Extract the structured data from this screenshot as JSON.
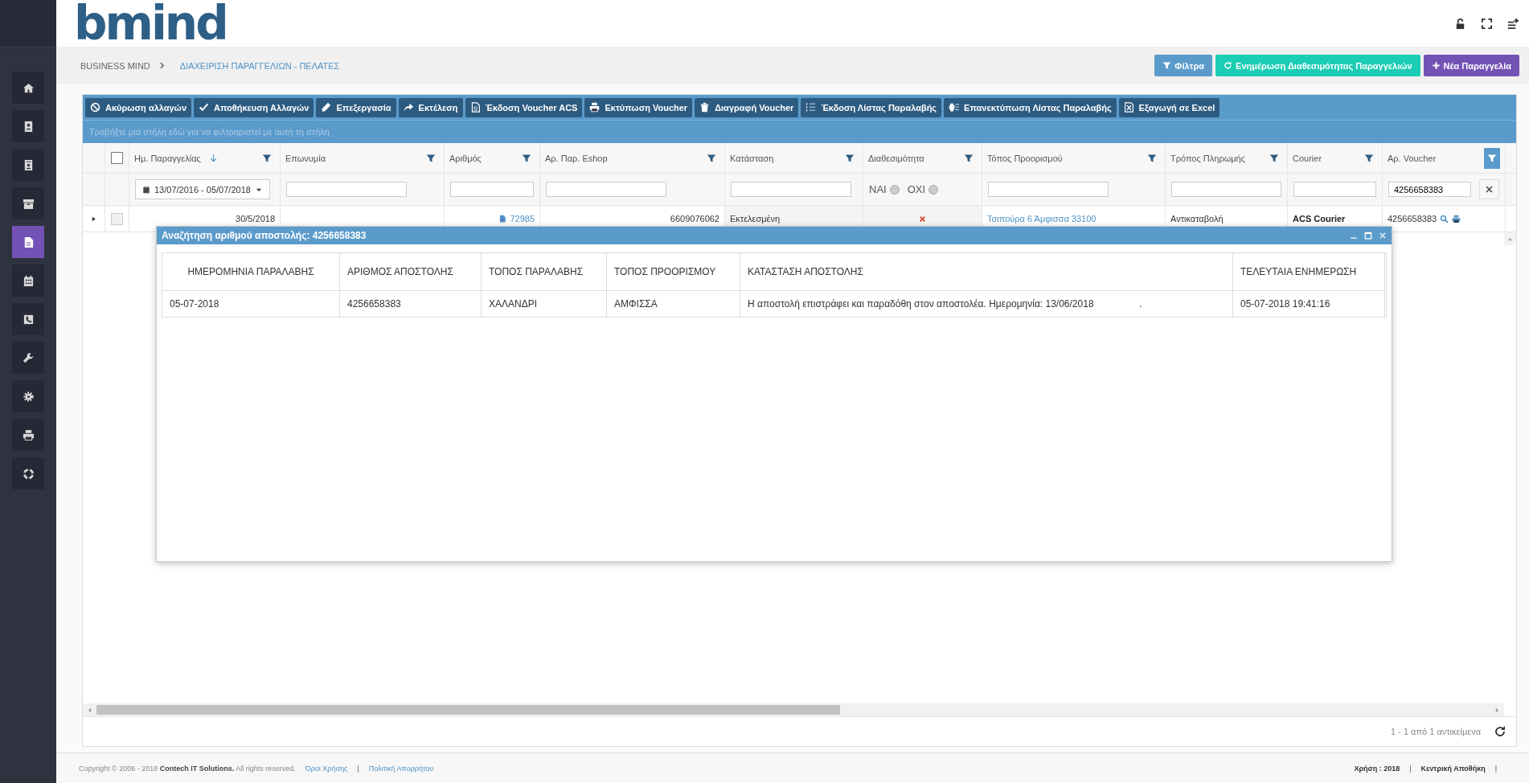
{
  "logo": {
    "text": "bmind"
  },
  "sidebar": {
    "items": [
      {
        "selected": false
      },
      {
        "selected": false
      },
      {
        "selected": false
      },
      {
        "selected": false
      },
      {
        "selected": true
      },
      {
        "selected": false
      },
      {
        "selected": false
      },
      {
        "selected": false
      },
      {
        "selected": false
      },
      {
        "selected": false
      },
      {
        "selected": false
      }
    ]
  },
  "breadcrumb": {
    "root": "BUSINESS MIND",
    "current": "ΔΙΑΧΕΙΡΙΣΗ ΠΑΡΑΓΓΕΛΙΩΝ - ΠΕΛΑΤΕΣ"
  },
  "action_buttons": [
    {
      "label": "Φίλτρα",
      "kind": "filter",
      "color": "#5b9bcb"
    },
    {
      "label": "Ενημέρωση Διαθεσιμότητας Παραγγελιών",
      "kind": "refresh",
      "color": "#1bcdb4"
    },
    {
      "label": "Νέα Παραγγελία",
      "kind": "add",
      "color": "#7452b5"
    }
  ],
  "toolbar": [
    {
      "label": "Ακύρωση αλλαγών"
    },
    {
      "label": "Αποθήκευση Αλλαγών"
    },
    {
      "label": "Επεξεργασία"
    },
    {
      "label": "Εκτέλεση"
    },
    {
      "label": "Έκδοση Voucher ACS"
    },
    {
      "label": "Εκτύπωση Voucher"
    },
    {
      "label": "Διαγραφή Voucher"
    },
    {
      "label": "Έκδοση Λίστας Παραλαβής"
    },
    {
      "label": "Επανεκτύπωση Λίστας Παραλαβής"
    },
    {
      "label": "Εξαγωγή σε Excel"
    }
  ],
  "grid": {
    "group_hint": "Τραβήξτε μια στήλη εδώ για να φιλτραριστεί με αυτή τη στήλη",
    "select_all_checked": false,
    "columns": [
      {
        "label": "Ημ. Παραγγελίας",
        "sorted": true,
        "filtered": false
      },
      {
        "label": "Επωνυμία",
        "sorted": false,
        "filtered": false
      },
      {
        "label": "Αριθμός",
        "sorted": false,
        "filtered": false
      },
      {
        "label": "Αρ. Παρ. Eshop",
        "sorted": false,
        "filtered": false
      },
      {
        "label": "Κατάσταση",
        "sorted": false,
        "filtered": false
      },
      {
        "label": "Διαθεσιμότητα",
        "sorted": false,
        "filtered": false
      },
      {
        "label": "Τόπος Προορισμού",
        "sorted": false,
        "filtered": false
      },
      {
        "label": "Τρόπος Πληρωμής",
        "sorted": false,
        "filtered": false
      },
      {
        "label": "Courier",
        "sorted": false,
        "filtered": false
      },
      {
        "label": "Αρ. Voucher",
        "sorted": false,
        "filtered": true
      }
    ],
    "filters": [
      {
        "kind": "daterange",
        "value": "13/07/2016 - 05/07/2018"
      },
      {
        "kind": "text"
      },
      {
        "kind": "text"
      },
      {
        "kind": "text"
      },
      {
        "kind": "text"
      },
      {
        "kind": "radio",
        "options": [
          {
            "label": "ΝΑΙ",
            "selected": false
          },
          {
            "label": "ΟΧΙ",
            "selected": false
          }
        ]
      },
      {
        "kind": "text"
      },
      {
        "kind": "text"
      },
      {
        "kind": "text"
      },
      {
        "kind": "text",
        "value": "4256658383"
      }
    ],
    "rows": [
      {
        "expanded": false,
        "checked": false,
        "date": "30/5/2018",
        "number": "72985",
        "eshop": "6609076062",
        "status": "Εκτελεσμένη",
        "available": false,
        "destination": "Τσιπούρα 6 Άμφισσα 33100",
        "payment": "Αντικαταβολή",
        "courier": "ACS Courier",
        "voucher": "4256658383"
      }
    ],
    "pager": "1 - 1 από 1 αντικείμενα"
  },
  "dialog": {
    "title": "Αναζήτηση αριθμού αποστολής: 4256658383",
    "columns": [
      "ΗΜΕΡΟΜΗΝΙΑ ΠΑΡΑΛΑΒΗΣ",
      "ΑΡΙΘΜΟΣ ΑΠΟΣΤΟΛΗΣ",
      "ΤΟΠΟΣ ΠΑΡΑΛΑΒΗΣ",
      "ΤΟΠΟΣ ΠΡΟΟΡΙΣΜΟΥ",
      "ΚΑΤΑΣΤΑΣΗ ΑΠΟΣΤΟΛΗΣ",
      "ΤΕΛΕΥΤΑΙΑ ΕΝΗΜΕΡΩΣΗ"
    ],
    "rows": [
      [
        "05-07-2018",
        "4256658383",
        "ΧΑΛΑΝΔΡΙ",
        "ΑΜΦΙΣΣΑ",
        "Η αποστολή επιστράφει και παραδόθη στον αποστολέα. Ημερομηνία: 13/06/2018                 .",
        "05-07-2018 19:41:16"
      ]
    ]
  },
  "footer": {
    "copyright": "Copyright © 2006 - 2018 **Contech IT Solutions.** All rights reserved.",
    "left": [
      {
        "kind": "link",
        "text": "Όροι Χρήσης"
      },
      {
        "kind": "sep",
        "text": "|"
      },
      {
        "kind": "link",
        "text": "Πολιτική Απορρήτου"
      }
    ],
    "right": [
      {
        "kind": "info",
        "text": "Χρήση : 2018"
      },
      {
        "kind": "sep",
        "text": "|"
      },
      {
        "kind": "info",
        "text": "Κεντρική Αποθήκη"
      },
      {
        "kind": "sep",
        "text": "|"
      }
    ]
  }
}
